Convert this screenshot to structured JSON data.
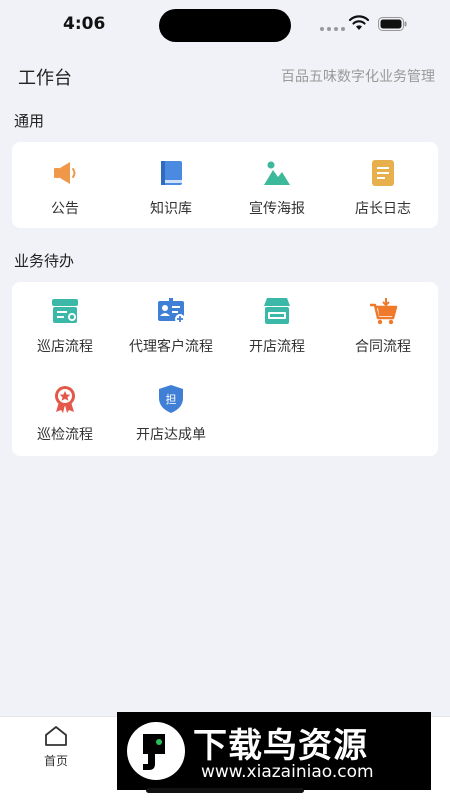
{
  "status_bar": {
    "time": "4:06"
  },
  "header": {
    "title": "工作台",
    "subtitle": "百品五味数字化业务管理"
  },
  "sections": [
    {
      "title": "通用",
      "items": [
        {
          "label": "公告",
          "icon": "megaphone-icon"
        },
        {
          "label": "知识库",
          "icon": "book-icon"
        },
        {
          "label": "宣传海报",
          "icon": "image-icon"
        },
        {
          "label": "店长日志",
          "icon": "document-icon"
        }
      ]
    },
    {
      "title": "业务待办",
      "items": [
        {
          "label": "巡店流程",
          "icon": "store-patrol-icon"
        },
        {
          "label": "代理客户流程",
          "icon": "agent-card-icon"
        },
        {
          "label": "开店流程",
          "icon": "store-open-icon"
        },
        {
          "label": "合同流程",
          "icon": "cart-icon"
        },
        {
          "label": "巡检流程",
          "icon": "badge-icon"
        },
        {
          "label": "开店达成单",
          "icon": "shield-icon"
        }
      ]
    }
  ],
  "tabbar": {
    "home_label": "首页"
  },
  "watermark": {
    "title": "下载鸟资源",
    "url": "www.xiazainiao.com"
  },
  "colors": {
    "background": "#f1f2f7",
    "card": "#ffffff",
    "accent_teal": "#3cb8a8",
    "accent_blue": "#3f7fd6",
    "accent_orange": "#f08a3c"
  }
}
